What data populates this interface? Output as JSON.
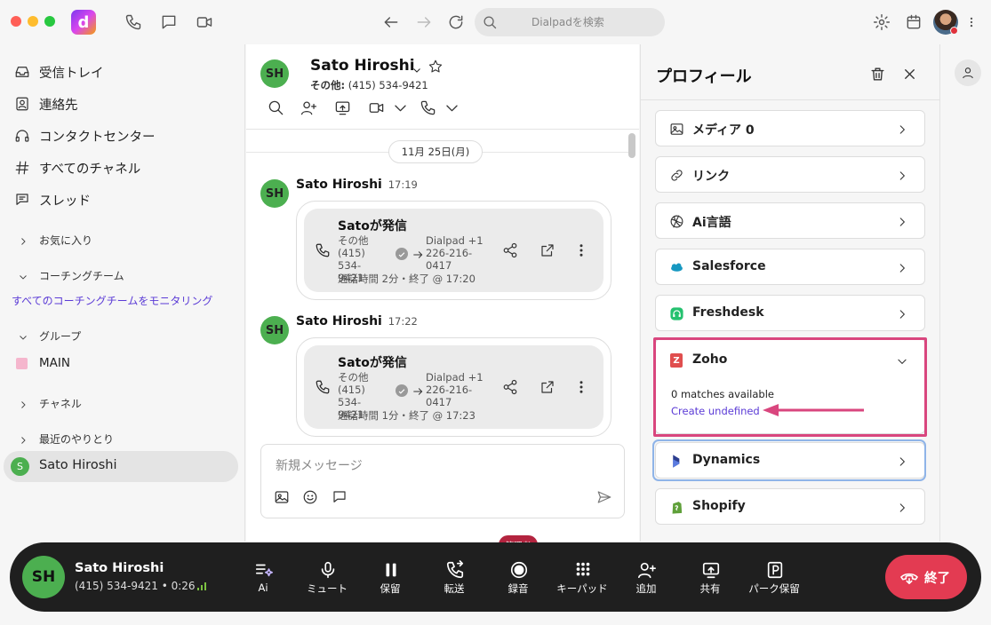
{
  "titlebar": {
    "app_logo": "d",
    "search_placeholder": "Dialpadを検索",
    "icons": [
      "phone-icon",
      "chat-icon",
      "video-icon",
      "back-icon",
      "forward-icon",
      "refresh-icon",
      "search-icon",
      "gear-icon",
      "calendar-icon",
      "more-icon"
    ]
  },
  "sidebar": {
    "nav": [
      {
        "label": "受信トレイ",
        "icon": "inbox-icon"
      },
      {
        "label": "連絡先",
        "icon": "contacts-icon"
      },
      {
        "label": "コンタクトセンター",
        "icon": "headset-icon"
      },
      {
        "label": "すべてのチャネル",
        "icon": "hash-icon"
      },
      {
        "label": "スレッド",
        "icon": "thread-icon"
      }
    ],
    "favorites": "お気に入り",
    "coaching": "コーチングチーム",
    "coaching_link": "すべてのコーチングチームをモニタリング",
    "groups": "グループ",
    "group_main": "MAIN",
    "channels": "チャネル",
    "recent": "最近のやりとり",
    "recent_contact_initial": "S",
    "recent_contact": "Sato Hiroshi"
  },
  "chat": {
    "avatar": "SH",
    "name": "Sato Hiroshi",
    "sub_prefix": "その他:",
    "sub_number": "(415) 534-9421",
    "date_pill": "11月 25日(月)",
    "messages": [
      {
        "avatar": "SH",
        "name": "Sato Hiroshi",
        "time": "17:19",
        "title": "Satoが発信",
        "from_l1": "その他",
        "from_l2": "(415) 534-",
        "from_l3": "9421",
        "to_l1": "Dialpad +1",
        "to_l2": "226-216-",
        "to_l3": "0417",
        "duration": "通話時間 2分・終了 @ 17:20"
      },
      {
        "avatar": "SH",
        "name": "Sato Hiroshi",
        "time": "17:22",
        "title": "Satoが発信",
        "from_l1": "その他",
        "from_l2": "(415) 534-",
        "from_l3": "9421",
        "to_l1": "Dialpad +1",
        "to_l2": "226-216-",
        "to_l3": "0417",
        "duration": "通話時間 1分・終了 @ 17:23"
      }
    ],
    "compose_placeholder": "新規メッセージ"
  },
  "profile": {
    "title": "プロフィール",
    "sections": [
      {
        "label": "メディア 0",
        "icon": "image-icon"
      },
      {
        "label": "リンク",
        "icon": "link-icon"
      },
      {
        "label": "Ai言語",
        "icon": "ai-language-icon"
      },
      {
        "label": "Salesforce",
        "icon": "salesforce-icon"
      },
      {
        "label": "Freshdesk",
        "icon": "freshdesk-icon"
      }
    ],
    "zoho": {
      "label": "Zoho",
      "logo": "Z",
      "matches": "0 matches available",
      "create": "Create undefined"
    },
    "sections_after": [
      {
        "label": "Dynamics",
        "icon": "dynamics-icon"
      },
      {
        "label": "Shopify",
        "icon": "shopify-icon"
      }
    ],
    "colors": {
      "highlight": "#d9467e",
      "link": "#5b3bd6"
    }
  },
  "callbar": {
    "avatar": "SH",
    "name": "Sato Hiroshi",
    "number": "(415) 534-9421",
    "timer": "• 0:26",
    "admin_badge": "管理者",
    "buttons": [
      {
        "label": "Ai",
        "icon": "ai-icon"
      },
      {
        "label": "ミュート",
        "icon": "mic-icon"
      },
      {
        "label": "保留",
        "icon": "pause-icon"
      },
      {
        "label": "転送",
        "icon": "transfer-icon"
      },
      {
        "label": "録音",
        "icon": "record-icon"
      },
      {
        "label": "キーパッド",
        "icon": "keypad-icon"
      },
      {
        "label": "追加",
        "icon": "add-person-icon"
      },
      {
        "label": "共有",
        "icon": "share-screen-icon"
      },
      {
        "label": "パーク保留",
        "icon": "park-icon"
      }
    ],
    "end_label": "終了",
    "colors": {
      "end": "#e33b52",
      "bar": "#1f1f1f",
      "admin": "#b3243f"
    }
  }
}
